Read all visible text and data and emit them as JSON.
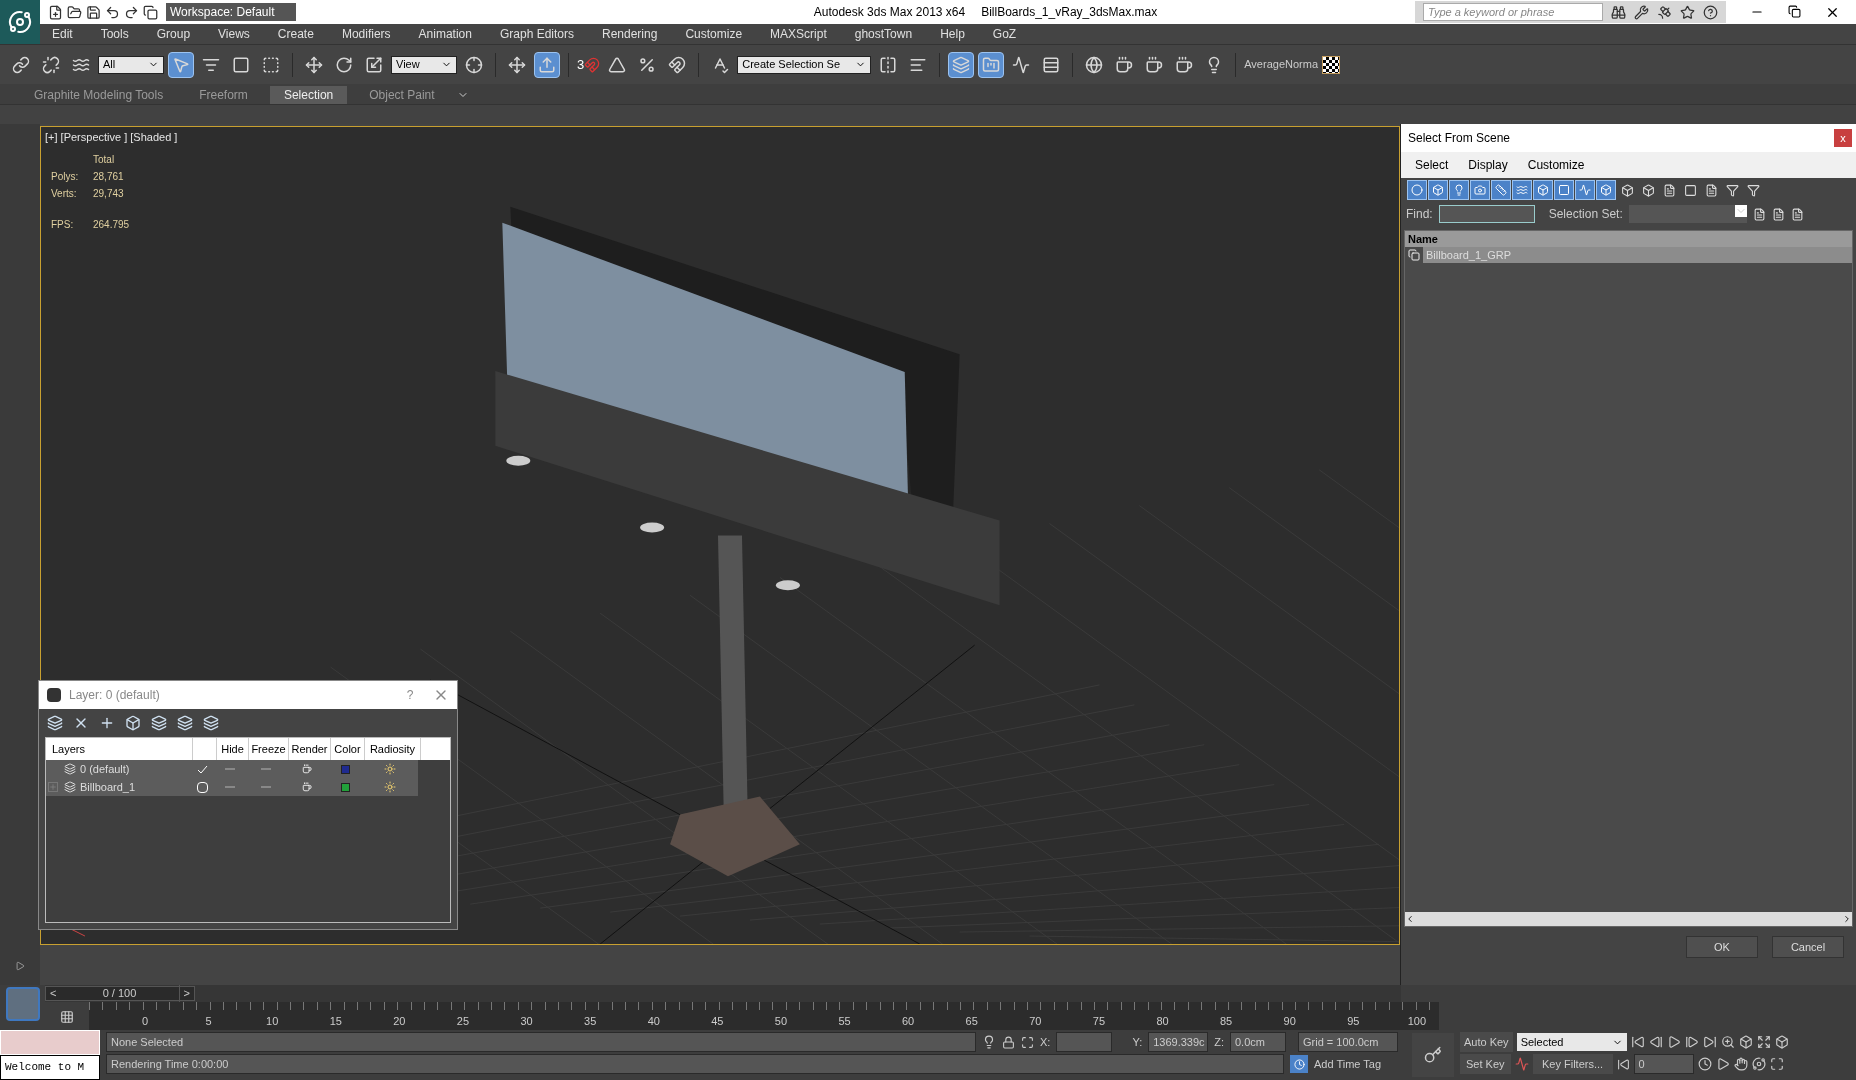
{
  "title_bar": {
    "workspace": "Workspace: Default",
    "app_title": "Autodesk 3ds Max  2013 x64",
    "file_name": "BillBoards_1_vRay_3dsMax.max",
    "search_placeholder": "Type a keyword or phrase"
  },
  "menu": [
    "Edit",
    "Tools",
    "Group",
    "Views",
    "Create",
    "Modifiers",
    "Animation",
    "Graph Editors",
    "Rendering",
    "Customize",
    "MAXScript",
    "ghostTown",
    "Help",
    "GoZ"
  ],
  "main_toolbar": {
    "selection_filter": "All",
    "reference_coord": "View",
    "snap_dimension": "3",
    "named_selection": "Create Selection Se",
    "plugin_label": "AverageNorma"
  },
  "ribbon_tabs": [
    {
      "label": "Graphite Modeling Tools",
      "selected": false
    },
    {
      "label": "Freeform",
      "selected": false
    },
    {
      "label": "Selection",
      "selected": true
    },
    {
      "label": "Object Paint",
      "selected": false
    }
  ],
  "viewport": {
    "label": "[+] [Perspective ] [Shaded ]",
    "stats_header": "Total",
    "stats": [
      {
        "label": "Polys:",
        "value": "28,761"
      },
      {
        "label": "Verts:",
        "value": "29,743"
      }
    ],
    "fps_label": "FPS:",
    "fps": "264.795"
  },
  "layer_dialog": {
    "title": "Layer: 0 (default)",
    "help": "?",
    "columns": [
      "Layers",
      "Hide",
      "Freeze",
      "Render",
      "Color",
      "Radiosity"
    ],
    "rows": [
      {
        "name": "0 (default)",
        "current": true,
        "expandable": false,
        "selected": true,
        "color": "#1f2a8f"
      },
      {
        "name": "Billboard_1",
        "current": false,
        "expandable": true,
        "selected": true,
        "color": "#22a03a"
      }
    ]
  },
  "scene_explorer": {
    "title": "Select From Scene",
    "close": "x",
    "menu": [
      "Select",
      "Display",
      "Customize"
    ],
    "find_label": "Find:",
    "selection_set_label": "Selection Set:",
    "column": "Name",
    "rows": [
      {
        "name": "Billboard_1_GRP",
        "selected": true
      }
    ],
    "buttons": [
      "OK",
      "Cancel"
    ]
  },
  "time_slider": {
    "prev": "<",
    "label": "0 / 100",
    "next": ">"
  },
  "track_ticks": [
    "0",
    "5",
    "10",
    "15",
    "20",
    "25",
    "30",
    "35",
    "40",
    "45",
    "50",
    "55",
    "60",
    "65",
    "70",
    "75",
    "80",
    "85",
    "90",
    "95",
    "100"
  ],
  "status": {
    "listener": "Welcome to M",
    "selection": "None Selected",
    "rendering_time": "Rendering Time  0:00:00",
    "x_label": "X:",
    "y_label": "Y:",
    "y_value": "1369.339c",
    "z_label": "Z:",
    "z_value": "0.0cm",
    "grid": "Grid = 100.0cm",
    "add_time_tag": "Add Time Tag",
    "auto_key": "Auto Key",
    "set_key": "Set Key",
    "key_mode": "Selected",
    "key_filters": "Key Filters...",
    "frame": "0"
  }
}
